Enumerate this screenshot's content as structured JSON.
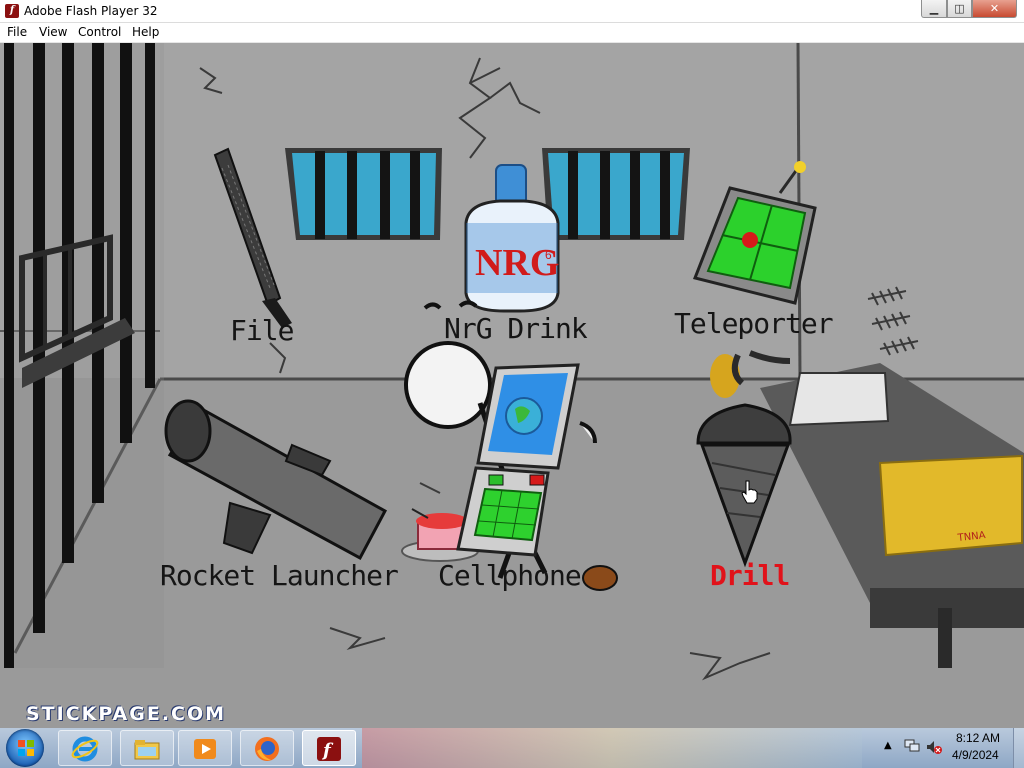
{
  "window": {
    "title": "Adobe Flash Player 32",
    "app_icon_glyph": "f",
    "minimize_glyph": "▁",
    "maximize_glyph": "◫",
    "close_glyph": "✕"
  },
  "menu": {
    "items": [
      "File",
      "View",
      "Control",
      "Help"
    ]
  },
  "game": {
    "items": [
      {
        "label": "File",
        "icon": "file-tool-icon",
        "highlighted": false
      },
      {
        "label": "NrG Drink",
        "icon": "energy-drink-bottle-icon",
        "highlighted": false
      },
      {
        "label": "Teleporter",
        "icon": "teleporter-device-icon",
        "highlighted": false
      },
      {
        "label": "Rocket Launcher",
        "icon": "rocket-launcher-icon",
        "highlighted": false
      },
      {
        "label": "Cellphone",
        "icon": "cellphone-icon",
        "highlighted": false
      },
      {
        "label": "Drill",
        "icon": "drill-icon",
        "highlighted": true
      }
    ],
    "bottle_logo": "NRG",
    "bottle_superscript": "6",
    "box_text": "TNNA",
    "watermark": "STICKPAGE.COM",
    "highlight_color": "#e1121a"
  },
  "taskbar": {
    "pinned": [
      {
        "name": "internet-explorer-icon"
      },
      {
        "name": "file-explorer-icon"
      },
      {
        "name": "media-player-icon"
      },
      {
        "name": "firefox-icon"
      },
      {
        "name": "flash-player-icon",
        "active": true
      }
    ],
    "tray_arrow": "▲",
    "time": "8:12 AM",
    "date": "4/9/2024"
  }
}
